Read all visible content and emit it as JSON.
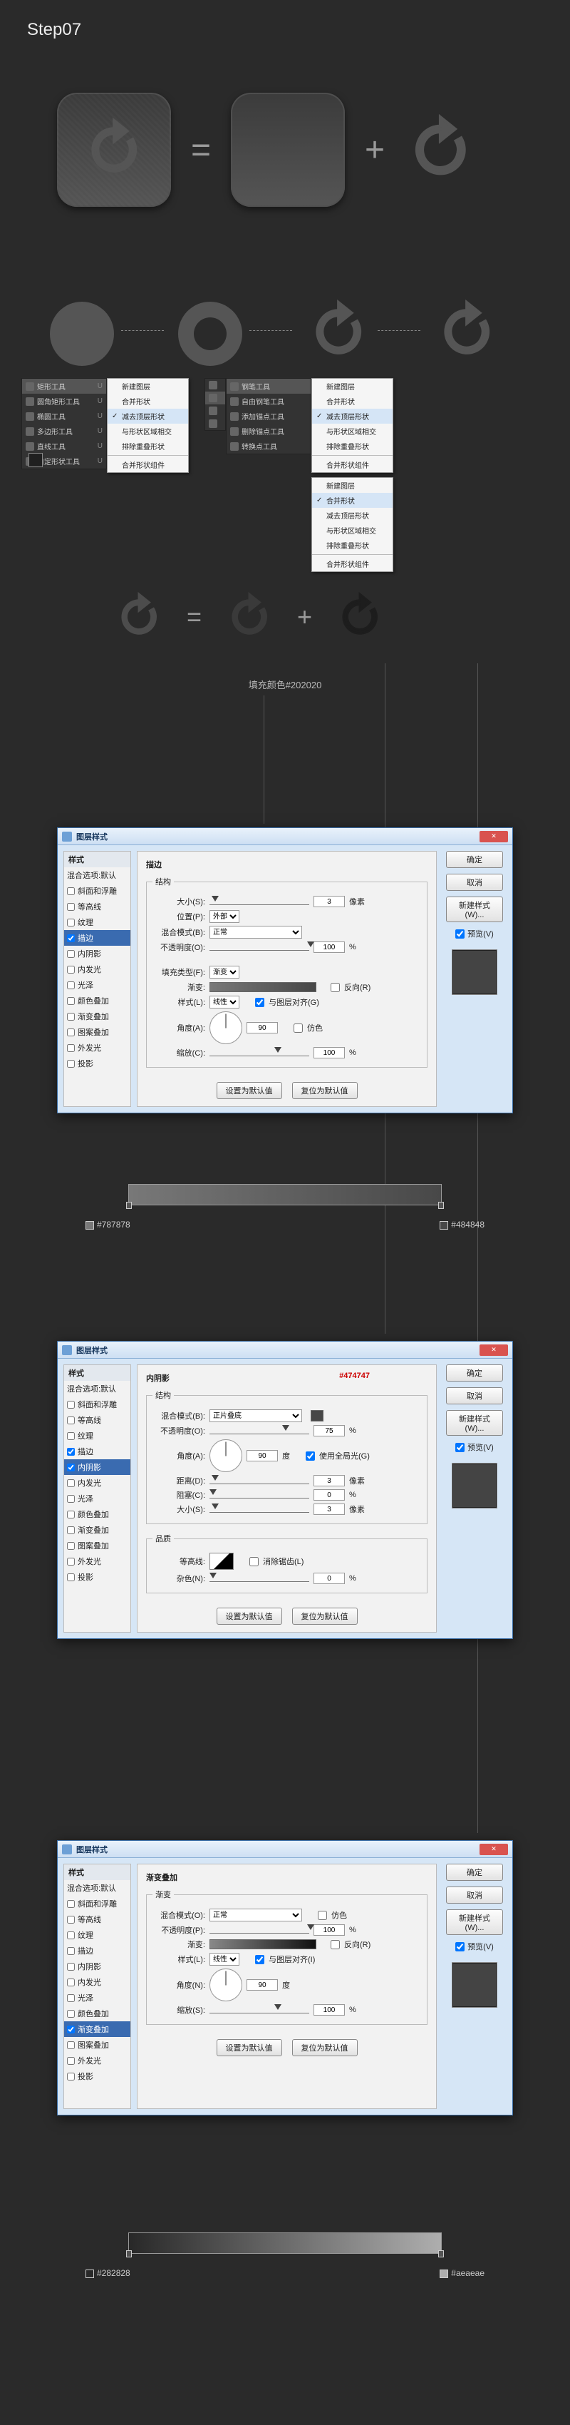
{
  "step_title": "Step07",
  "op_equals": "=",
  "op_plus": "+",
  "fill_color_note": "填充颜色#202020",
  "tool_panels": {
    "shape_tools": [
      {
        "label": "矩形工具",
        "key": "U"
      },
      {
        "label": "圆角矩形工具",
        "key": "U"
      },
      {
        "label": "椭圆工具",
        "key": "U"
      },
      {
        "label": "多边形工具",
        "key": "U"
      },
      {
        "label": "直线工具",
        "key": "U"
      },
      {
        "label": "自定形状工具",
        "key": "U"
      }
    ],
    "menu_1": [
      {
        "label": "新建图层"
      },
      {
        "label": "合并形状"
      },
      {
        "label": "减去顶层形状",
        "checked": true
      },
      {
        "label": "与形状区域相交"
      },
      {
        "label": "排除重叠形状"
      },
      {
        "sep": true
      },
      {
        "label": "合并形状组件"
      }
    ],
    "pen_tools": [
      {
        "label": "钢笔工具",
        "key": ""
      },
      {
        "label": "自由钢笔工具",
        "key": ""
      },
      {
        "label": "添加锚点工具",
        "key": ""
      },
      {
        "label": "删除锚点工具",
        "key": ""
      },
      {
        "label": "转换点工具",
        "key": ""
      }
    ],
    "menu_2": [
      {
        "label": "新建图层"
      },
      {
        "label": "合并形状",
        "checked": true
      },
      {
        "label": "减去顶层形状"
      },
      {
        "label": "与形状区域相交"
      },
      {
        "label": "排除重叠形状"
      },
      {
        "sep": true
      },
      {
        "label": "合并形状组件"
      }
    ],
    "menu_3": [
      {
        "label": "新建图层"
      },
      {
        "label": "合并形状"
      },
      {
        "label": "减去顶层形状",
        "checked": true
      },
      {
        "label": "与形状区域相交"
      },
      {
        "label": "排除重叠形状"
      },
      {
        "sep": true
      },
      {
        "label": "合并形状组件"
      }
    ]
  },
  "dialog_common": {
    "title": "图层样式",
    "styles_header": "样式",
    "ok": "确定",
    "cancel": "取消",
    "new_style": "新建样式(W)...",
    "preview_label": "预览(V)",
    "make_default": "设置为默认值",
    "reset_default": "复位为默认值",
    "style_items": [
      "混合选项:默认",
      "斜面和浮雕",
      "等高线",
      "纹理",
      "描边",
      "内阴影",
      "内发光",
      "光泽",
      "颜色叠加",
      "渐变叠加",
      "图案叠加",
      "外发光",
      "投影"
    ]
  },
  "dialog_1": {
    "selected_style": "描边",
    "checked": [
      "描边"
    ],
    "section": "描边",
    "fieldset_struct": "结构",
    "rows": {
      "size_label": "大小(S):",
      "size_val": "3",
      "size_suffix": "像素",
      "pos_label": "位置(P):",
      "pos_val": "外部",
      "blend_label": "混合模式(B):",
      "blend_val": "正常",
      "opacity_label": "不透明度(O):",
      "opacity_val": "100",
      "opacity_suffix": "%",
      "fill_type_label": "填充类型(F):",
      "fill_type_val": "渐变",
      "grad_label": "渐变:",
      "reverse": "反向(R)",
      "style_label": "样式(L):",
      "style_val": "线性",
      "align_layer": "与图层对齐(G)",
      "angle_label": "角度(A):",
      "angle_val": "90",
      "dither": "仿色",
      "scale_label": "缩放(C):",
      "scale_val": "100",
      "scale_suffix": "%"
    }
  },
  "dialog_2": {
    "selected_style": "内阴影",
    "checked": [
      "描边",
      "内阴影"
    ],
    "red_note": "#474747",
    "section": "内阴影",
    "fieldset_struct": "结构",
    "fieldset_qual": "品质",
    "rows": {
      "blend_label": "混合模式(B):",
      "blend_val": "正片叠底",
      "opacity_label": "不透明度(O):",
      "opacity_val": "75",
      "opacity_suffix": "%",
      "angle_label": "角度(A):",
      "angle_val": "90",
      "deg": "度",
      "global": "使用全局光(G)",
      "dist_label": "距离(D):",
      "dist_val": "3",
      "dist_suffix": "像素",
      "choke_label": "阻塞(C):",
      "choke_val": "0",
      "choke_suffix": "%",
      "size_label": "大小(S):",
      "size_val": "3",
      "size_suffix": "像素",
      "contour_label": "等高线:",
      "anti": "消除锯齿(L)",
      "noise_label": "杂色(N):",
      "noise_val": "0",
      "noise_suffix": "%"
    }
  },
  "dialog_3": {
    "selected_style": "渐变叠加",
    "checked": [
      "渐变叠加"
    ],
    "section": "渐变叠加",
    "fieldset": "渐变",
    "rows": {
      "blend_label": "混合模式(O):",
      "blend_val": "正常",
      "dither": "仿色",
      "opacity_label": "不透明度(P):",
      "opacity_val": "100",
      "opacity_suffix": "%",
      "grad_label": "渐变:",
      "reverse": "反向(R)",
      "style_label": "样式(L):",
      "style_val": "线性",
      "align_layer": "与图层对齐(I)",
      "angle_label": "角度(N):",
      "angle_val": "90",
      "deg": "度",
      "scale_label": "缩放(S):",
      "scale_val": "100",
      "scale_suffix": "%"
    }
  },
  "grad_1": {
    "c1": "#787878",
    "c2": "#484848"
  },
  "grad_3": {
    "c1": "#282828",
    "c2": "#aeaeae"
  }
}
